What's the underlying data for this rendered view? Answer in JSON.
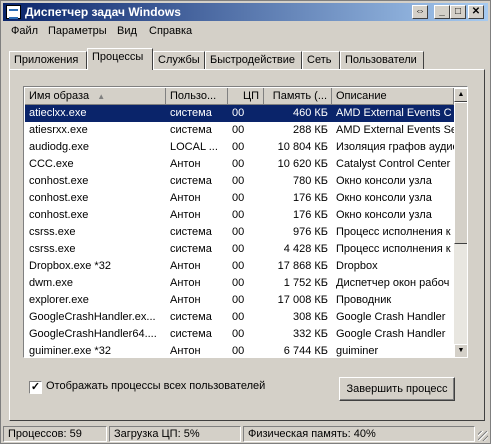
{
  "window": {
    "title": "Диспетчер задач Windows",
    "buttons": {
      "restore": "⇔",
      "minimize": "_",
      "maximize": "□",
      "close": "✕"
    }
  },
  "menu": [
    "Файл",
    "Параметры",
    "Вид",
    "Справка"
  ],
  "tabs": [
    "Приложения",
    "Процессы",
    "Службы",
    "Быстродействие",
    "Сеть",
    "Пользователи"
  ],
  "active_tab": "Процессы",
  "table": {
    "columns": [
      "Имя образа",
      "Пользо...",
      "ЦП",
      "Память (...",
      "Описание"
    ],
    "sort_indicator": "▲",
    "rows": [
      [
        "atieclxx.exe",
        "система",
        "00",
        "460 КБ",
        "AMD External Events C"
      ],
      [
        "atiesrxx.exe",
        "система",
        "00",
        "288 КБ",
        "AMD External Events Se"
      ],
      [
        "audiodg.exe",
        "LOCAL ...",
        "00",
        "10 804 КБ",
        "Изоляция графов аудио"
      ],
      [
        "CCC.exe",
        "Антон",
        "00",
        "10 620 КБ",
        "Catalyst Control Center"
      ],
      [
        "conhost.exe",
        "система",
        "00",
        "780 КБ",
        "Окно консоли узла"
      ],
      [
        "conhost.exe",
        "Антон",
        "00",
        "176 КБ",
        "Окно консоли узла"
      ],
      [
        "conhost.exe",
        "Антон",
        "00",
        "176 КБ",
        "Окно консоли узла"
      ],
      [
        "csrss.exe",
        "система",
        "00",
        "976 КБ",
        "Процесс исполнения к"
      ],
      [
        "csrss.exe",
        "система",
        "00",
        "4 428 КБ",
        "Процесс исполнения к"
      ],
      [
        "Dropbox.exe *32",
        "Антон",
        "00",
        "17 868 КБ",
        "Dropbox"
      ],
      [
        "dwm.exe",
        "Антон",
        "00",
        "1 752 КБ",
        "Диспетчер окон рабоч"
      ],
      [
        "explorer.exe",
        "Антон",
        "00",
        "17 008 КБ",
        "Проводник"
      ],
      [
        "GoogleCrashHandler.ex...",
        "система",
        "00",
        "308 КБ",
        "Google Crash Handler"
      ],
      [
        "GoogleCrashHandler64....",
        "система",
        "00",
        "332 КБ",
        "Google Crash Handler"
      ],
      [
        "guiminer.exe *32",
        "Антон",
        "00",
        "6 744 КБ",
        "guiminer"
      ]
    ],
    "selected_row": 0
  },
  "scroll_arrows": {
    "up": "▲",
    "down": "▼"
  },
  "show_all_users": {
    "label": "Отображать процессы всех пользователей",
    "checked": true,
    "mark": "✓"
  },
  "end_process_button": "Завершить процесс",
  "status": {
    "processes": "Процессов: 59",
    "cpu": "Загрузка ЦП: 5%",
    "memory": "Физическая память: 40%"
  }
}
